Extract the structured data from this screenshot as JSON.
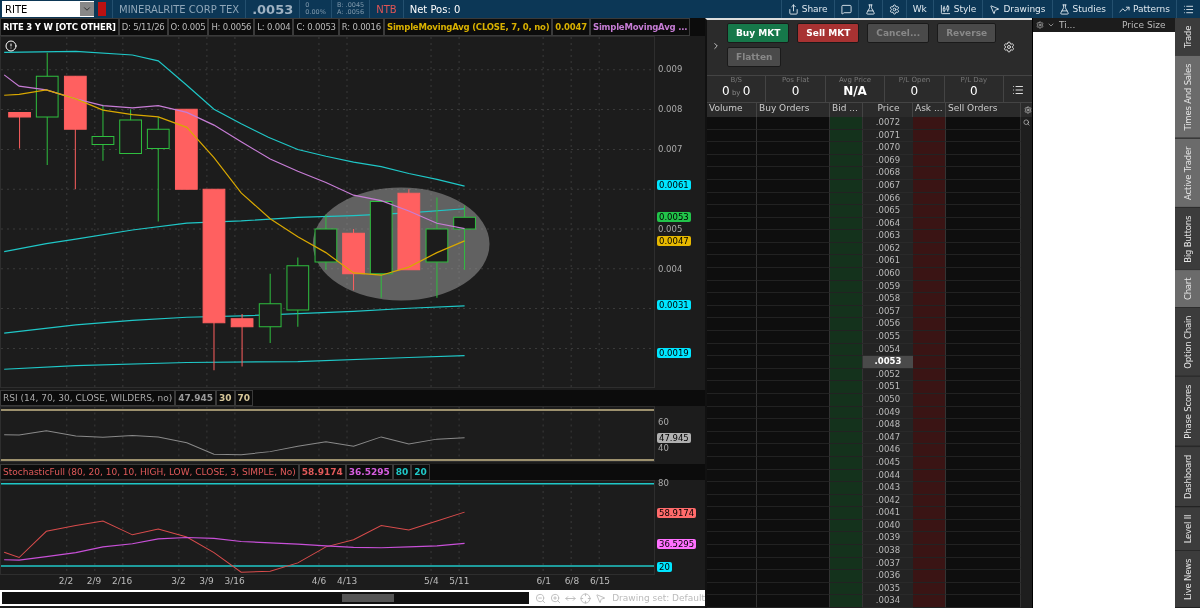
{
  "header": {
    "symbol": "RITE",
    "company": "MINERALRITE CORP TEX",
    "last": ".0053",
    "change": "0",
    "change_pct": "0.00%",
    "bid": "B: .0045",
    "ask": "A: .0056",
    "tag": "NTB",
    "net_pos": "Net Pos: 0"
  },
  "toolbar": [
    {
      "kind": "share",
      "label": "Share"
    },
    {
      "kind": "message"
    },
    {
      "kind": "flask"
    },
    {
      "kind": "gear"
    },
    {
      "kind": "text",
      "label": "Wk"
    },
    {
      "kind": "style",
      "label": "Style"
    },
    {
      "kind": "drawings",
      "label": "Drawings"
    },
    {
      "kind": "studies",
      "label": "Studies"
    },
    {
      "kind": "patterns",
      "label": "Patterns"
    },
    {
      "kind": "menu"
    }
  ],
  "chart": {
    "title": "RITE 3 Y W [OTC OTHER]",
    "info": [
      "D: 5/11/26",
      "O: 0.005",
      "H: 0.0056",
      "L: 0.004",
      "C: 0.0053",
      "R: 0.0016"
    ],
    "studies": [
      {
        "text": "SimpleMovingAvg (CLOSE, 7, 0, no)",
        "color": "#d9b100"
      },
      {
        "text": "0.0047",
        "color": "#d9b100"
      },
      {
        "text": "SimpleMovingAvg ...",
        "color": "#c77dd6"
      }
    ],
    "price_ticks": [
      "0.009",
      "0.008",
      "0.007",
      "0.005",
      "0.004"
    ],
    "price_badges": [
      {
        "text": "0.0061",
        "color": "#00e5ff"
      },
      {
        "text": "0.0053",
        "color": "#22c44a"
      },
      {
        "text": "0.0047",
        "color": "#e6b800"
      },
      {
        "text": "0.0031",
        "color": "#00e5ff"
      },
      {
        "text": "0.0019",
        "color": "#00e5ff"
      }
    ],
    "rsi": {
      "label": "RSI (14, 70, 30, CLOSE, WILDERS, no)",
      "values": [
        {
          "text": "47.945",
          "color": "#9a9a9a"
        },
        {
          "text": "30",
          "color": "#d8c89a"
        },
        {
          "text": "70",
          "color": "#d8c89a"
        }
      ],
      "ticks": [
        "60",
        "40"
      ],
      "badges": [
        {
          "text": "47.945",
          "color": "#b0b0b0"
        }
      ]
    },
    "stoch": {
      "label": "StochasticFull (80, 20, 10, 10, HIGH, LOW, CLOSE, 3, SIMPLE, No)",
      "values": [
        {
          "text": "58.9174",
          "color": "#e05a5a"
        },
        {
          "text": "36.5295",
          "color": "#d65ee0"
        },
        {
          "text": "80",
          "color": "#1fc7c7"
        },
        {
          "text": "20",
          "color": "#1fc7c7"
        }
      ],
      "ticks": [
        "80"
      ],
      "badges": [
        {
          "text": "58.9174",
          "color": "#ff6b6b"
        },
        {
          "text": "36.5295",
          "color": "#ff70ff"
        },
        {
          "text": "20",
          "color": "#00e5ff"
        }
      ]
    },
    "dates": [
      "2/2",
      "2/9",
      "2/16",
      "3/2",
      "3/9",
      "3/16",
      "4/6",
      "4/13",
      "5/4",
      "5/11",
      "6/1",
      "6/8",
      "6/15"
    ],
    "drawing_set": "Drawing set: Default"
  },
  "active_trader": {
    "buttons": [
      {
        "label": "Buy MKT",
        "kind": "buy",
        "disabled": false
      },
      {
        "label": "Sell MKT",
        "kind": "sell",
        "disabled": false
      },
      {
        "label": "Cancel...",
        "kind": "plain",
        "disabled": true
      },
      {
        "label": "Reverse",
        "kind": "plain",
        "disabled": true
      },
      {
        "label": "Flatten",
        "kind": "plain",
        "disabled": true
      }
    ],
    "stats": [
      {
        "label": "B/S",
        "parts": [
          "0",
          "by",
          "0"
        ],
        "bold": false
      },
      {
        "label": "Pos Flat",
        "parts": [
          "0"
        ],
        "bold": false
      },
      {
        "label": "Avg Price",
        "parts": [
          "N/A"
        ],
        "bold": true
      },
      {
        "label": "P/L Open",
        "parts": [
          "0"
        ],
        "bold": false
      },
      {
        "label": "P/L Day",
        "parts": [
          "0"
        ],
        "bold": false
      }
    ],
    "columns": [
      "Volume",
      "Buy Orders",
      "Bid ...",
      "Price",
      "Ask ...",
      "Sell Orders"
    ],
    "rows": [
      {
        "price": ".0072",
        "selected": false
      },
      {
        "price": ".0071",
        "selected": false
      },
      {
        "price": ".0070",
        "selected": false
      },
      {
        "price": ".0069",
        "selected": false
      },
      {
        "price": ".0068",
        "selected": false
      },
      {
        "price": ".0067",
        "selected": false
      },
      {
        "price": ".0066",
        "selected": false
      },
      {
        "price": ".0065",
        "selected": false
      },
      {
        "price": ".0064",
        "selected": false
      },
      {
        "price": ".0063",
        "selected": false
      },
      {
        "price": ".0062",
        "selected": false
      },
      {
        "price": ".0061",
        "selected": false
      },
      {
        "price": ".0060",
        "selected": false
      },
      {
        "price": ".0059",
        "selected": false
      },
      {
        "price": ".0058",
        "selected": false
      },
      {
        "price": ".0057",
        "selected": false
      },
      {
        "price": ".0056",
        "selected": false
      },
      {
        "price": ".0055",
        "selected": false
      },
      {
        "price": ".0054",
        "selected": false
      },
      {
        "price": ".0053",
        "selected": true
      },
      {
        "price": ".0052",
        "selected": false
      },
      {
        "price": ".0051",
        "selected": false
      },
      {
        "price": ".0050",
        "selected": false
      },
      {
        "price": ".0049",
        "selected": false
      },
      {
        "price": ".0048",
        "selected": false
      },
      {
        "price": ".0047",
        "selected": false
      },
      {
        "price": ".0046",
        "selected": false
      },
      {
        "price": ".0045",
        "selected": false
      },
      {
        "price": ".0044",
        "selected": false
      },
      {
        "price": ".0043",
        "selected": false
      },
      {
        "price": ".0042",
        "selected": false
      },
      {
        "price": ".0041",
        "selected": false
      },
      {
        "price": ".0040",
        "selected": false
      },
      {
        "price": ".0039",
        "selected": false
      },
      {
        "price": ".0038",
        "selected": false
      },
      {
        "price": ".0037",
        "selected": false
      },
      {
        "price": ".0036",
        "selected": false
      },
      {
        "price": ".0035",
        "selected": false
      },
      {
        "price": ".0034",
        "selected": false
      }
    ]
  },
  "time_and_sales": {
    "columns": [
      "Ti...",
      "Price",
      "Size"
    ]
  },
  "side_tabs": [
    {
      "label": "Trade",
      "selected": false
    },
    {
      "label": "Times And Sales",
      "selected": true
    },
    {
      "label": "Active Trader",
      "selected": true
    },
    {
      "label": "Big Buttons",
      "selected": false
    },
    {
      "label": "Chart",
      "selected": true
    },
    {
      "label": "Option Chain",
      "selected": false
    },
    {
      "label": "Phase Scores",
      "selected": false
    },
    {
      "label": "Dashboard",
      "selected": false
    },
    {
      "label": "Level II",
      "selected": false
    },
    {
      "label": "Live News",
      "selected": false
    }
  ]
}
